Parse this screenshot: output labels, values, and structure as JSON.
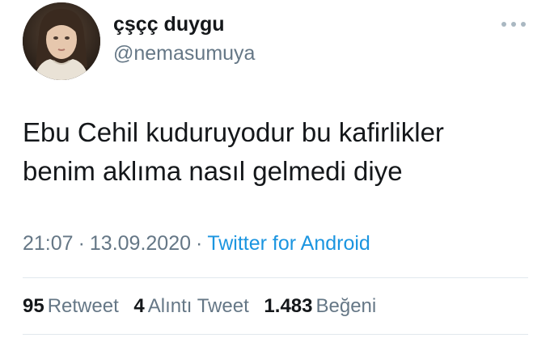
{
  "author": {
    "display_name": "çşçç duygu",
    "handle": "@nemasumuya"
  },
  "tweet": {
    "text_lines": [
      "Ebu Cehil kuduruyodur bu kafirlikler",
      "benim aklıma nasıl gelmedi diye"
    ],
    "time": "21:07",
    "separator": "·",
    "date": "13.09.2020",
    "source": "Twitter for Android"
  },
  "stats": {
    "retweets": {
      "count": "95",
      "label": "Retweet"
    },
    "quotes": {
      "count": "4",
      "label": "Alıntı Tweet"
    },
    "likes": {
      "count": "1.483",
      "label": "Beğeni"
    }
  },
  "icons": {
    "more": "more-dots-icon",
    "avatar": "profile-avatar"
  },
  "colors": {
    "text": "#14171a",
    "secondary": "#657786",
    "link": "#1b95e0",
    "divider": "#e1e8ed"
  }
}
